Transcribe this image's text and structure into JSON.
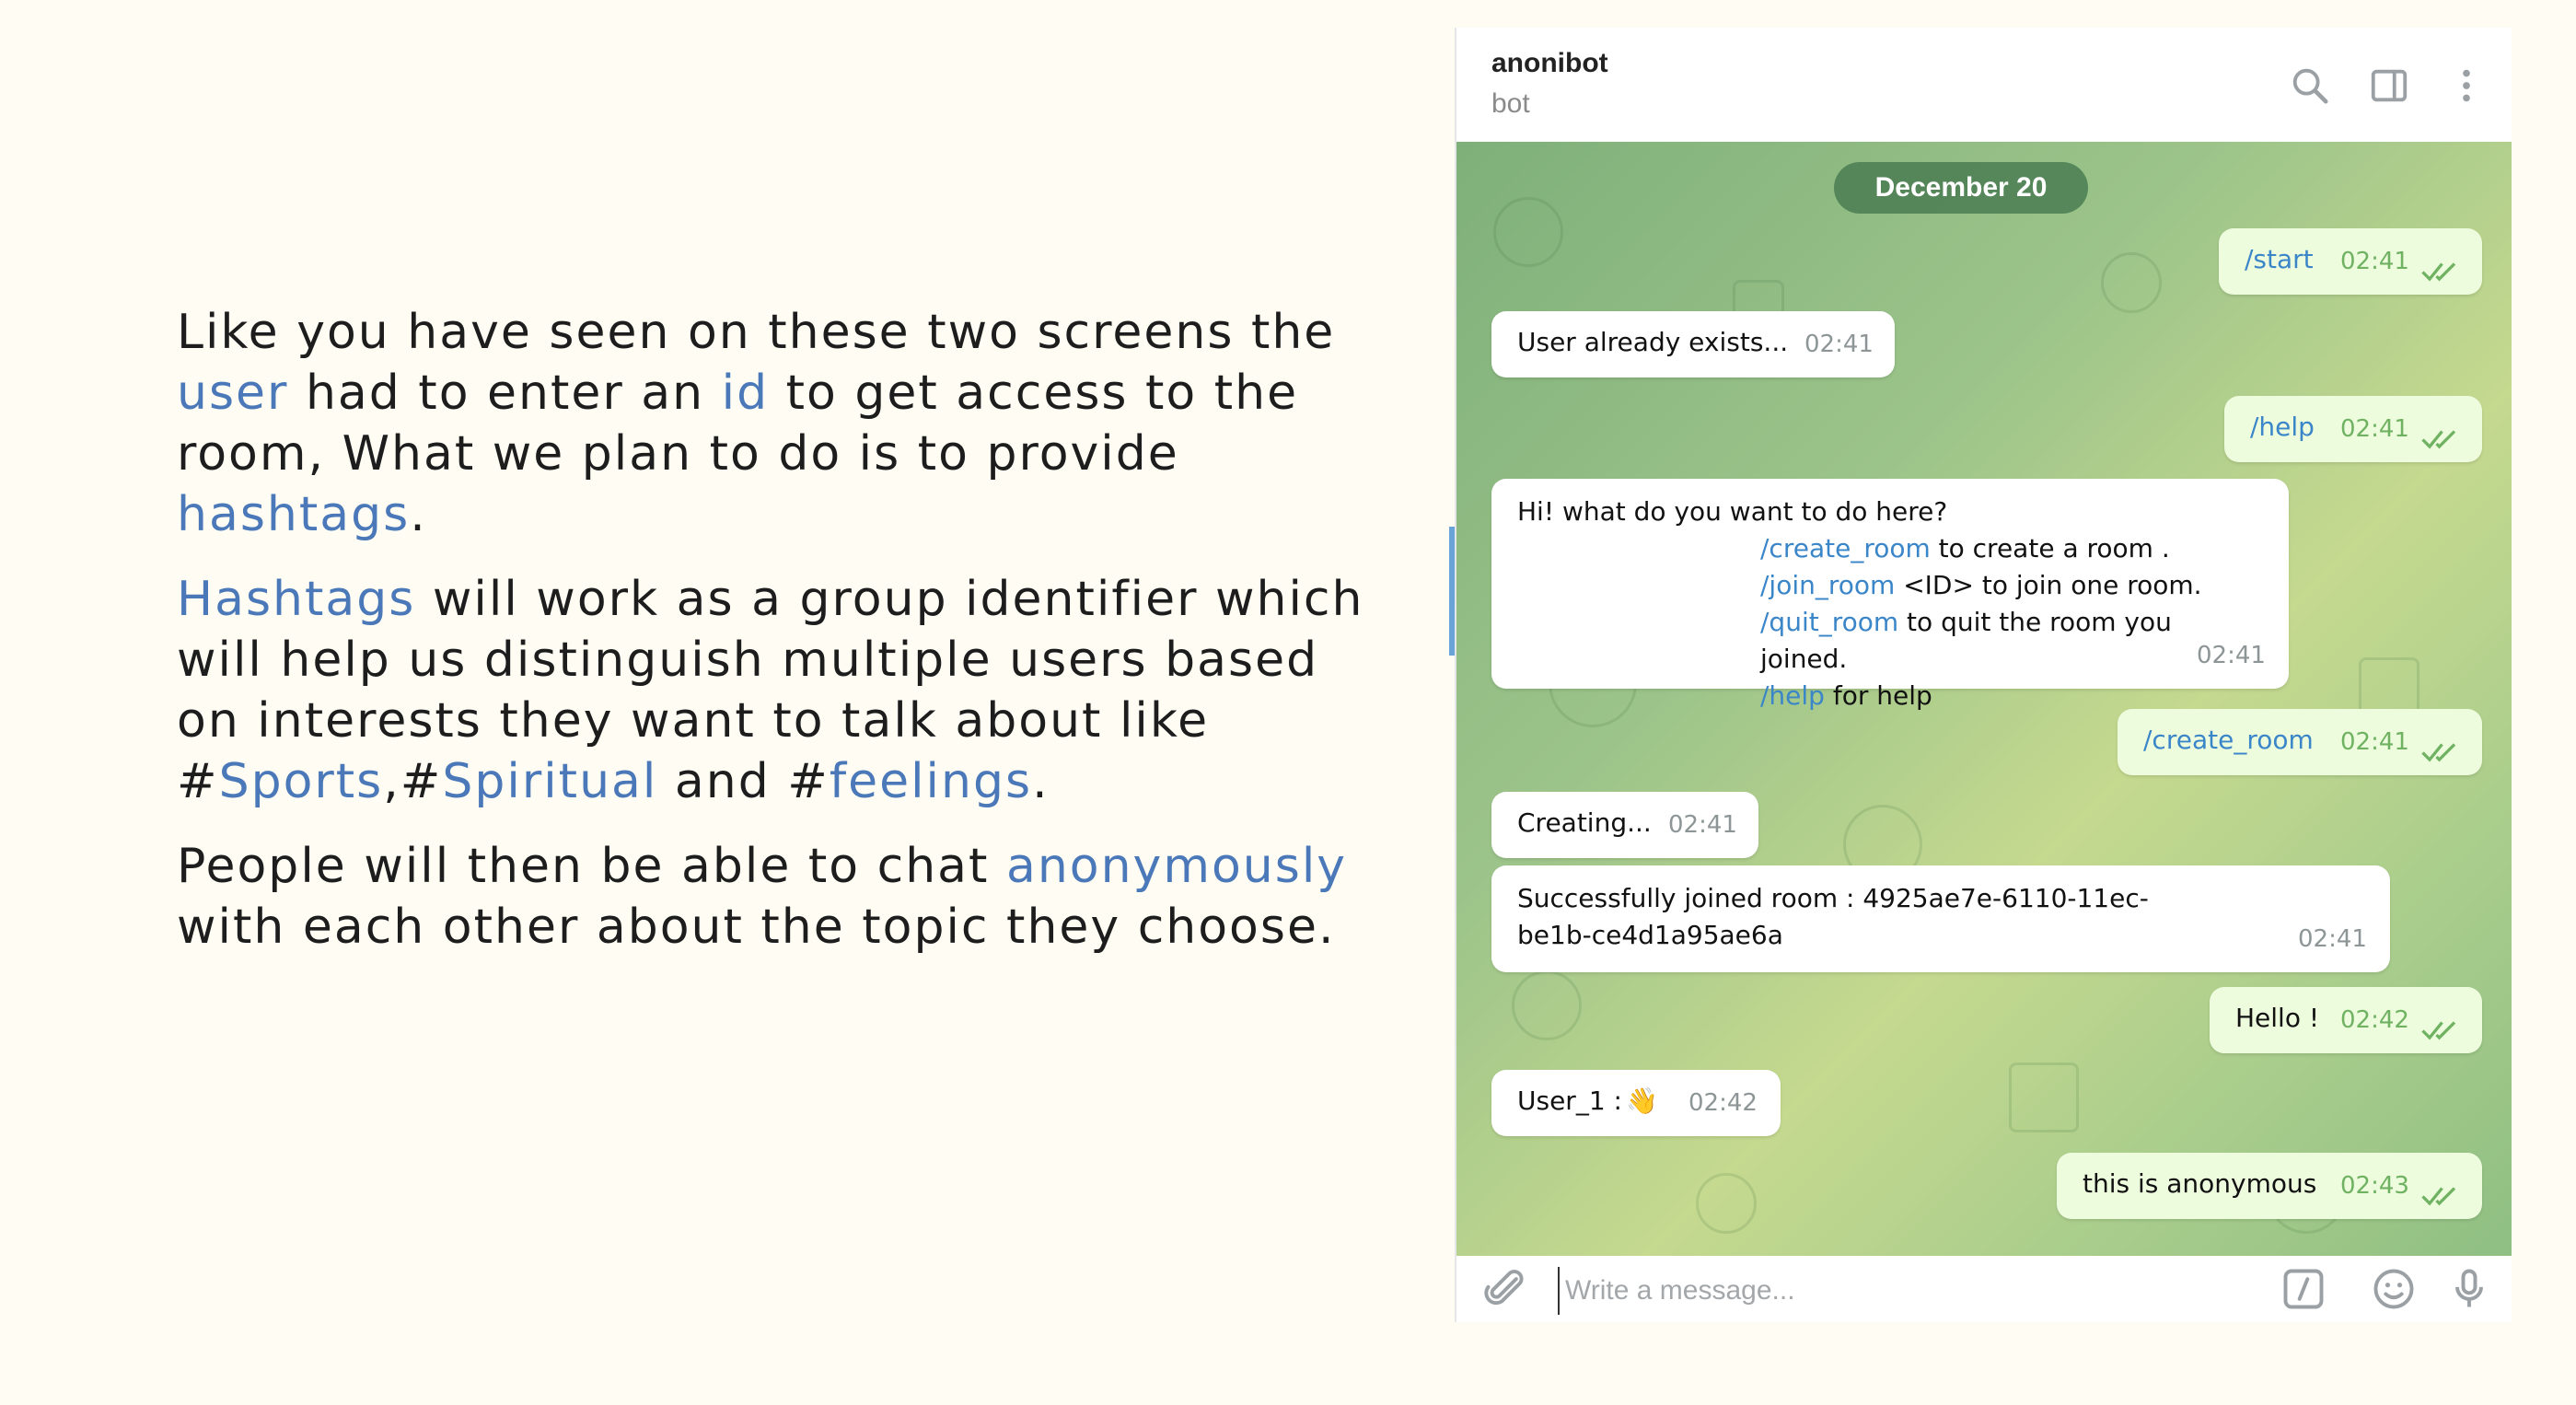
{
  "slide": {
    "p1": {
      "a": "Like you have seen on these two screens the ",
      "kw_user": "user",
      "b": " had to enter an ",
      "kw_id": "id",
      "c": " to get access to the room, What we plan to do is to provide ",
      "kw_hashtags": "hashtags",
      "d": "."
    },
    "p2": {
      "kw_hashtags": "Hashtags",
      "a": " will work as a group identifier which will help us distinguish multiple users based on interests they want to talk about like #",
      "kw_sports": "Sports",
      "b": ",#",
      "kw_spiritual": "Spiritual",
      "c": " and #",
      "kw_feelings": "feelings",
      "d": "."
    },
    "p3": {
      "a": "People will then be able to chat ",
      "kw_anon": "anonymously",
      "b": " with each other about the topic they choose."
    }
  },
  "chat": {
    "title": "anonibot",
    "subtitle": "bot",
    "date": "December 20",
    "messages": [
      {
        "text": "/start",
        "time": "02:41"
      },
      {
        "text": "User already exists...",
        "time": "02:41"
      },
      {
        "text": "/help",
        "time": "02:41"
      },
      {
        "intro": "Hi! what do you want to do here?",
        "lines": [
          {
            "cmd": "/create_room",
            "rest": " to create a room ."
          },
          {
            "cmd": "/join_room",
            "rest": " <ID> to join one room."
          },
          {
            "cmd": "/quit_room",
            "rest": " to quit the room you joined."
          },
          {
            "cmd": "/help",
            "rest": " for help"
          }
        ],
        "time": "02:41"
      },
      {
        "text": "/create_room",
        "time": "02:41"
      },
      {
        "text": "Creating...",
        "time": "02:41"
      },
      {
        "text": "Successfully joined room : 4925ae7e-6110-11ec-be1b-ce4d1a95ae6a",
        "time": "02:41"
      },
      {
        "text": "Hello !",
        "time": "02:42"
      },
      {
        "text": "User_1 :",
        "emoji": "👋",
        "time": "02:42"
      },
      {
        "text": "this is anonymous",
        "time": "02:43"
      }
    ],
    "input_placeholder": "Write a message..."
  },
  "colors": {
    "accent": "#4a78b8",
    "command_link": "#3a86c8",
    "outgoing_bubble": "#eefcde",
    "read_tick": "#6fb262"
  },
  "icons": [
    "search-icon",
    "sidebar-toggle-icon",
    "more-icon",
    "attach-icon",
    "bot-command-icon",
    "emoji-icon",
    "microphone-icon",
    "double-check-icon"
  ]
}
